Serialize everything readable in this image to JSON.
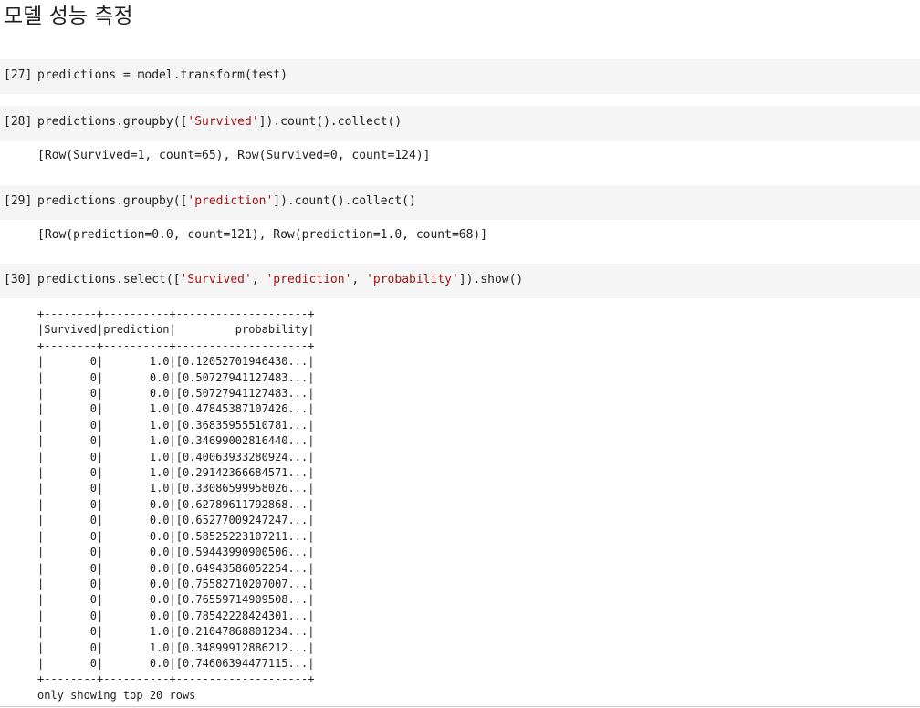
{
  "heading": "모델 성능 측정",
  "cells": [
    {
      "num": "[27]",
      "code_parts": [
        {
          "text": "predictions = model.transform(test)",
          "str": false
        }
      ],
      "output": ""
    },
    {
      "num": "[28]",
      "code_parts": [
        {
          "text": "predictions.groupby([",
          "str": false
        },
        {
          "text": "'Survived'",
          "str": true
        },
        {
          "text": "]).count().collect()",
          "str": false
        }
      ],
      "output": "[Row(Survived=1, count=65), Row(Survived=0, count=124)]"
    },
    {
      "num": "[29]",
      "code_parts": [
        {
          "text": "predictions.groupby([",
          "str": false
        },
        {
          "text": "'prediction'",
          "str": true
        },
        {
          "text": "]).count().collect()",
          "str": false
        }
      ],
      "output": "[Row(prediction=0.0, count=121), Row(prediction=1.0, count=68)]"
    },
    {
      "num": "[30]",
      "code_parts": [
        {
          "text": "predictions.select([",
          "str": false
        },
        {
          "text": "'Survived'",
          "str": true
        },
        {
          "text": ", ",
          "str": false
        },
        {
          "text": "'prediction'",
          "str": true
        },
        {
          "text": ", ",
          "str": false
        },
        {
          "text": "'probability'",
          "str": true
        },
        {
          "text": "]).show()",
          "str": false
        }
      ],
      "output": ""
    }
  ],
  "table": {
    "header": [
      "Survived",
      "prediction",
      "probability"
    ],
    "rows": [
      [
        "0",
        "1.0",
        "[0.12052701946430..."
      ],
      [
        "0",
        "0.0",
        "[0.50727941127483..."
      ],
      [
        "0",
        "0.0",
        "[0.50727941127483..."
      ],
      [
        "0",
        "1.0",
        "[0.47845387107426..."
      ],
      [
        "0",
        "1.0",
        "[0.36835955510781..."
      ],
      [
        "0",
        "1.0",
        "[0.34699002816440..."
      ],
      [
        "0",
        "1.0",
        "[0.40063933280924..."
      ],
      [
        "0",
        "1.0",
        "[0.29142366684571..."
      ],
      [
        "0",
        "1.0",
        "[0.33086599958026..."
      ],
      [
        "0",
        "0.0",
        "[0.62789611792868..."
      ],
      [
        "0",
        "0.0",
        "[0.65277009247247..."
      ],
      [
        "0",
        "0.0",
        "[0.58525223107211..."
      ],
      [
        "0",
        "0.0",
        "[0.59443990900506..."
      ],
      [
        "0",
        "0.0",
        "[0.64943586052254..."
      ],
      [
        "0",
        "0.0",
        "[0.75582710207007..."
      ],
      [
        "0",
        "0.0",
        "[0.76559714909508..."
      ],
      [
        "0",
        "0.0",
        "[0.78542228424301..."
      ],
      [
        "0",
        "1.0",
        "[0.21047868801234..."
      ],
      [
        "0",
        "1.0",
        "[0.34899912886212..."
      ],
      [
        "0",
        "0.0",
        "[0.74606394477115..."
      ]
    ],
    "footer": "only showing top 20 rows"
  }
}
